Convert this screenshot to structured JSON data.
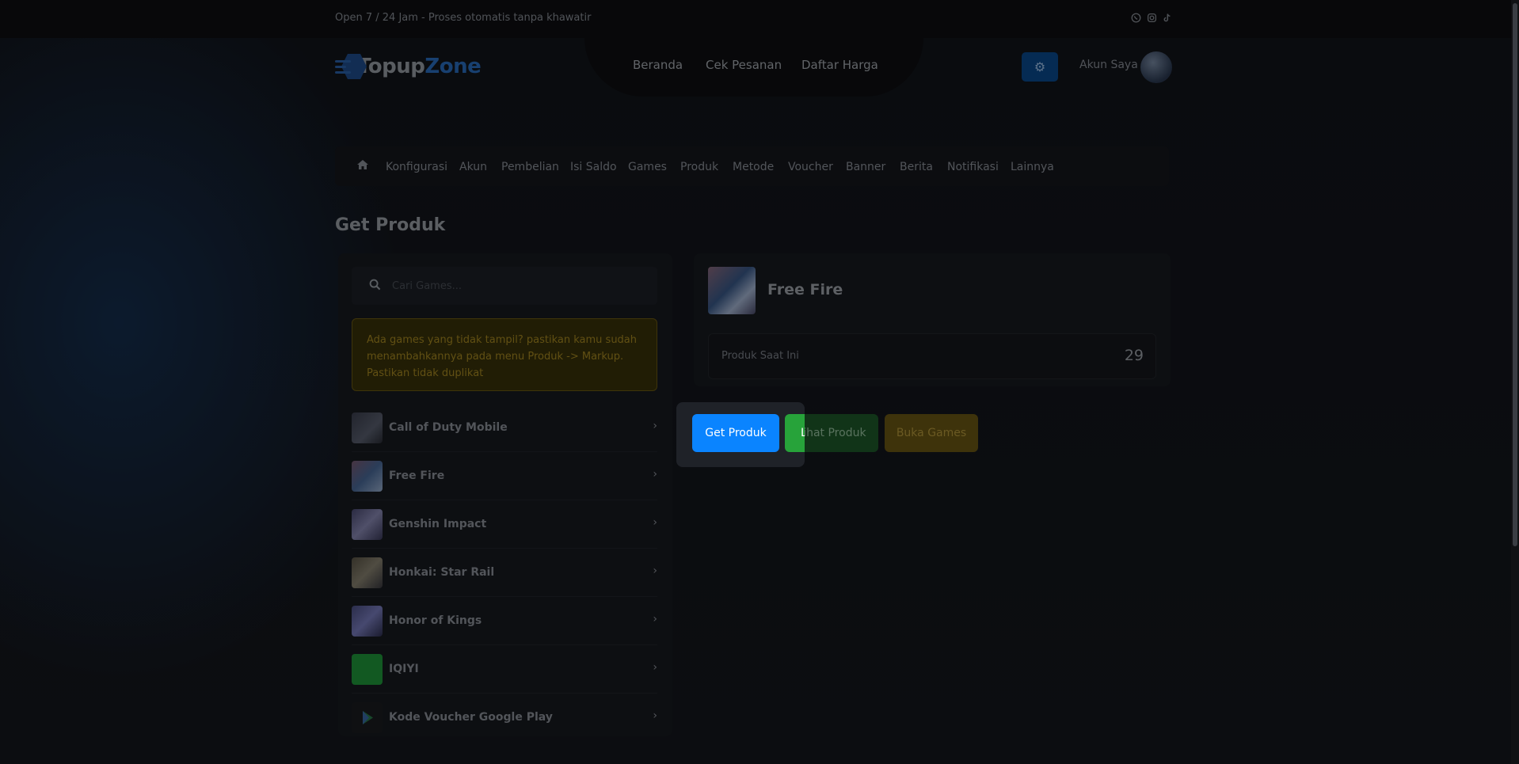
{
  "topbar": {
    "text": "Open 7 / 24 Jam - Proses otomatis tanpa khawatir",
    "social": [
      "whatsapp-icon",
      "instagram-icon",
      "tiktok-icon"
    ]
  },
  "logo": {
    "part1": "Topup",
    "part2": "Zone"
  },
  "nav": {
    "items": [
      "Beranda",
      "Cek Pesanan",
      "Daftar Harga"
    ]
  },
  "account": {
    "label": "Akun Saya"
  },
  "menu": {
    "items": [
      "Konfigurasi",
      "Akun",
      "Pembelian",
      "Isi Saldo",
      "Games",
      "Produk",
      "Metode",
      "Voucher",
      "Banner",
      "Berita",
      "Notifikasi",
      "Lainnya"
    ]
  },
  "page": {
    "title": "Get Produk"
  },
  "search": {
    "placeholder": "Cari Games..."
  },
  "alert": {
    "text": "Ada games yang tidak tampil? pastikan kamu sudah menambahkannya pada menu Produk -> Markup. Pastikan tidak duplikat"
  },
  "games": [
    {
      "name": "Call of Duty Mobile",
      "color": "#4a4f5e"
    },
    {
      "name": "Free Fire",
      "color": "#5a7ea8"
    },
    {
      "name": "Genshin Impact",
      "color": "#6a6a96"
    },
    {
      "name": "Honkai: Star Rail",
      "color": "#6e6a5a"
    },
    {
      "name": "Honor of Kings",
      "color": "#5b5f8e"
    },
    {
      "name": "IQIYI",
      "color": "#1f9a3c"
    },
    {
      "name": "Kode Voucher Google Play",
      "color": "#1a1c20"
    }
  ],
  "selected": {
    "name": "Free Fire",
    "stat_label": "Produk Saat Ini",
    "stat_value": "29"
  },
  "buttons": {
    "get": "Get Produk",
    "lihat": "Lihat Produk",
    "buka": "Buka Games"
  },
  "colors": {
    "primary": "#0a84ff",
    "success": "#27a33a",
    "warning": "#c9a227"
  }
}
